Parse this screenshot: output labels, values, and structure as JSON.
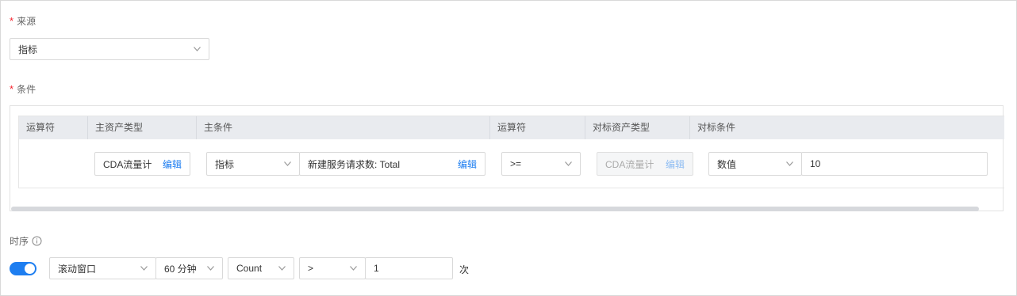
{
  "source": {
    "label": "来源",
    "required_mark": "*",
    "selected": "指标"
  },
  "condition": {
    "label": "条件",
    "required_mark": "*",
    "columns": [
      "运算符",
      "主资产类型",
      "主条件",
      "运算符",
      "对标资产类型",
      "对标条件"
    ],
    "row": {
      "main_asset": "CDA流量计",
      "main_asset_edit": "编辑",
      "main_condition_type": "指标",
      "main_condition_value": "新建服务请求数: Total",
      "main_condition_edit": "编辑",
      "operator": ">=",
      "benchmark_asset": "CDA流量计",
      "benchmark_asset_edit": "编辑",
      "benchmark_condition_type": "数值",
      "benchmark_condition_value": "10"
    }
  },
  "timing": {
    "label": "时序",
    "enabled": true,
    "window_type": "滚动窗口",
    "window_size": "60 分钟",
    "aggregation": "Count",
    "comparator": ">",
    "threshold": "1",
    "unit": "次"
  },
  "colors": {
    "accent": "#1e7ef0",
    "required": "#f5222d",
    "header_bg": "#e9ebef"
  }
}
